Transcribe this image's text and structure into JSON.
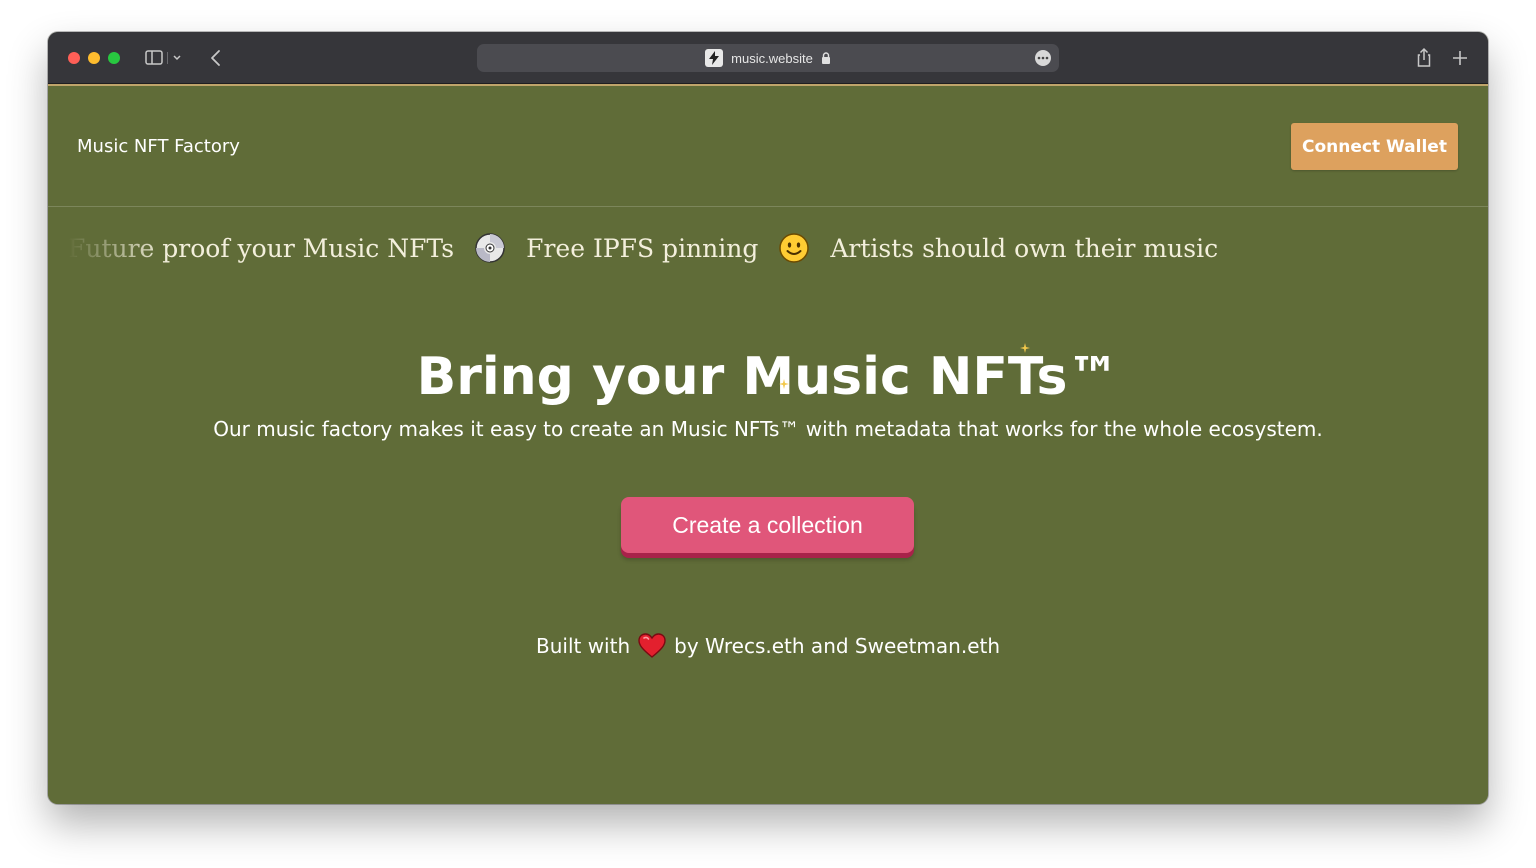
{
  "browser": {
    "url": "music.website"
  },
  "header": {
    "brand": "Music NFT Factory",
    "connect_label": "Connect Wallet"
  },
  "marquee": [
    {
      "text": "Future proof your Music NFTs",
      "emoji": "cd-disc-icon"
    },
    {
      "text": "Free IPFS pinning",
      "emoji": "smiley-face-icon"
    },
    {
      "text": "Artists should own their music",
      "emoji": ""
    }
  ],
  "hero": {
    "title_prefix": "Bring your ",
    "title_strong": "Music NFTs",
    "title_mark": "™",
    "subtitle": "Our music factory makes it easy to create an Music NFTs™ with metadata that works for the whole ecosystem.",
    "cta_label": "Create a collection"
  },
  "footer": {
    "prefix": "Built with",
    "suffix": "by Wrecs.eth and Sweetman.eth"
  },
  "colors": {
    "page_bg": "#606c38",
    "wallet_button": "#dda15e",
    "cta_button": "#e0567a",
    "cta_shadow": "#a8224a",
    "titlebar": "#36363a"
  }
}
